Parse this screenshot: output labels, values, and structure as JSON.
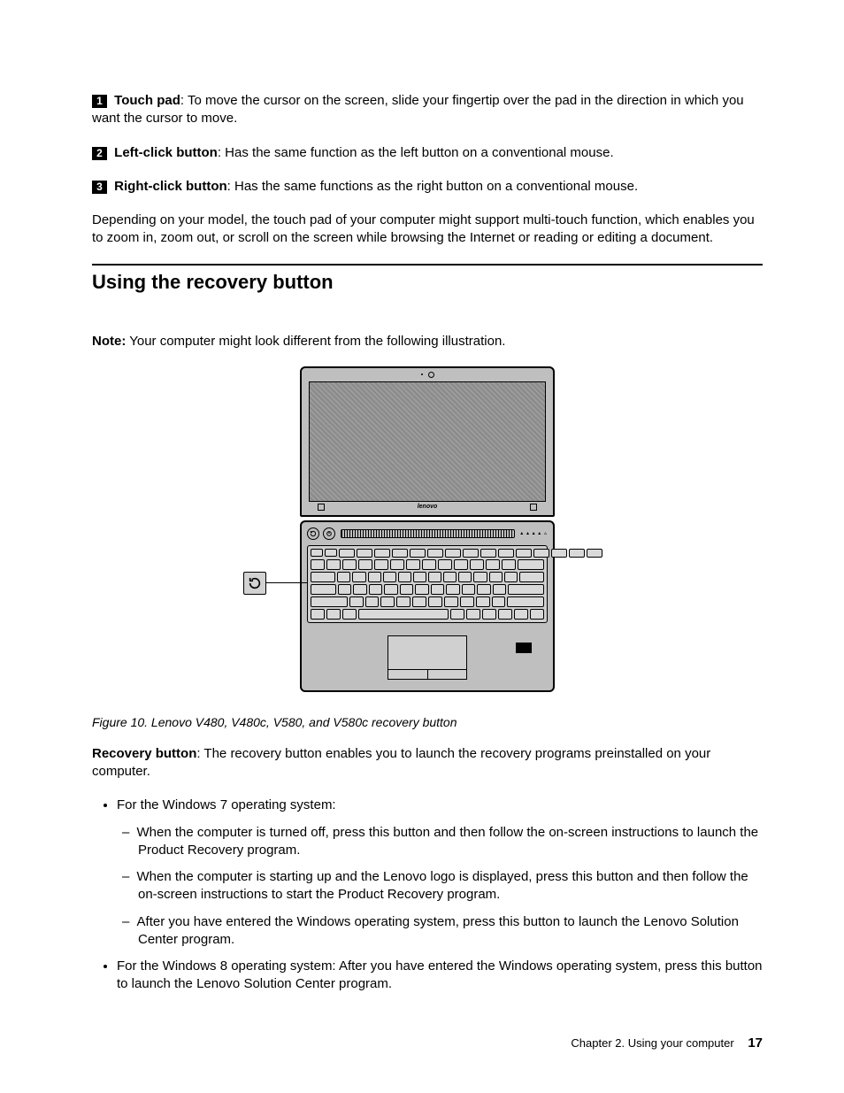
{
  "callouts": {
    "n1": "1",
    "t1_label": "Touch pad",
    "t1_desc": ": To move the cursor on the screen, slide your fingertip over the pad in the direction in which you want the cursor to move.",
    "n2": "2",
    "t2_label": "Left-click button",
    "t2_desc": ": Has the same function as the left button on a conventional mouse.",
    "n3": "3",
    "t3_label": "Right-click button",
    "t3_desc": ": Has the same functions as the right button on a conventional mouse."
  },
  "multitouch_para": "Depending on your model, the touch pad of your computer might support multi-touch function, which enables you to zoom in, zoom out, or scroll on the screen while browsing the Internet or reading or editing a document.",
  "section_heading": "Using the recovery button",
  "note_label": "Note:",
  "note_text": "Your computer might look different from the following illustration.",
  "illustration": {
    "brand": "lenovo",
    "callout_icon": "recovery-arrow-icon"
  },
  "figure_caption": "Figure 10.  Lenovo V480, V480c, V580, and V580c recovery button",
  "recovery_label": "Recovery button",
  "recovery_desc": ": The recovery button enables you to launch the recovery programs preinstalled on your computer.",
  "list": {
    "win7_intro": "For the Windows 7 operating system:",
    "win7_a": "When the computer is turned off, press this button and then follow the on-screen instructions to launch the Product Recovery program.",
    "win7_b": "When the computer is starting up and the Lenovo logo is displayed, press this button and then follow the on-screen instructions to start the Product Recovery program.",
    "win7_c": "After you have entered the Windows operating system, press this button to launch the Lenovo Solution Center program.",
    "win8": "For the Windows 8 operating system: After you have entered the Windows operating system, press this button to launch the Lenovo Solution Center program."
  },
  "footer": {
    "chapter": "Chapter 2.  Using your computer",
    "page": "17"
  }
}
